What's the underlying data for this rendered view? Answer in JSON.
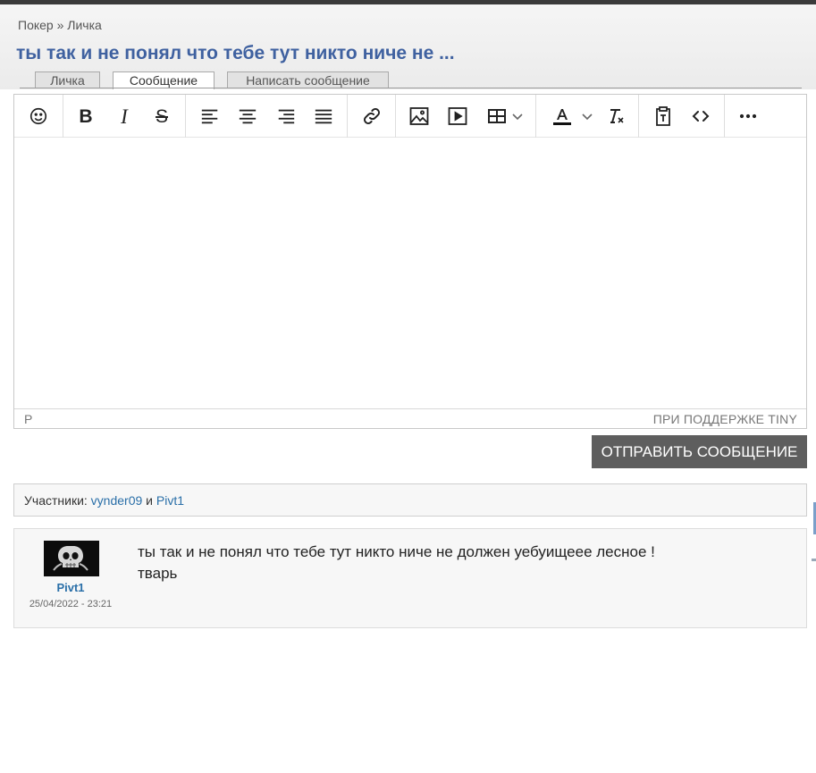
{
  "breadcrumb": {
    "root": "Покер",
    "separator": "»",
    "current": "Личка"
  },
  "title": "ты так и не понял что тебе тут никто ниче не ...",
  "tabs": [
    {
      "label": "Личка",
      "active": false
    },
    {
      "label": "Сообщение",
      "active": true
    },
    {
      "label": "Написать сообщение",
      "active": false
    }
  ],
  "editor": {
    "toolbar_icons": [
      "emoji-icon",
      "bold-icon",
      "italic-icon",
      "strikethrough-icon",
      "align-left-icon",
      "align-center-icon",
      "align-right-icon",
      "align-justify-icon",
      "link-icon",
      "image-icon",
      "media-icon",
      "table-icon",
      "text-color-icon",
      "clear-format-icon",
      "paste-text-icon",
      "source-code-icon",
      "more-icon"
    ],
    "bold_glyph": "B",
    "italic_glyph": "I",
    "strike_glyph": "S",
    "status_path": "P",
    "branding": "ПРИ ПОДДЕРЖКЕ TINY"
  },
  "send_label": "ОТПРАВИТЬ СООБЩЕНИЕ",
  "participants": {
    "label": "Участники:",
    "user1": "vynder09",
    "conjunction": "и",
    "user2": "Pivt1"
  },
  "message": {
    "author": "Pivt1",
    "date": "25/04/2022 - 23:21",
    "line1": "ты так и не понял что тебе тут никто ниче не должен уебуищеее лесное !",
    "line2": "тварь"
  },
  "colors": {
    "title": "#3f61a0",
    "link": "#2a6fa8",
    "button": "#5e5e5e"
  }
}
